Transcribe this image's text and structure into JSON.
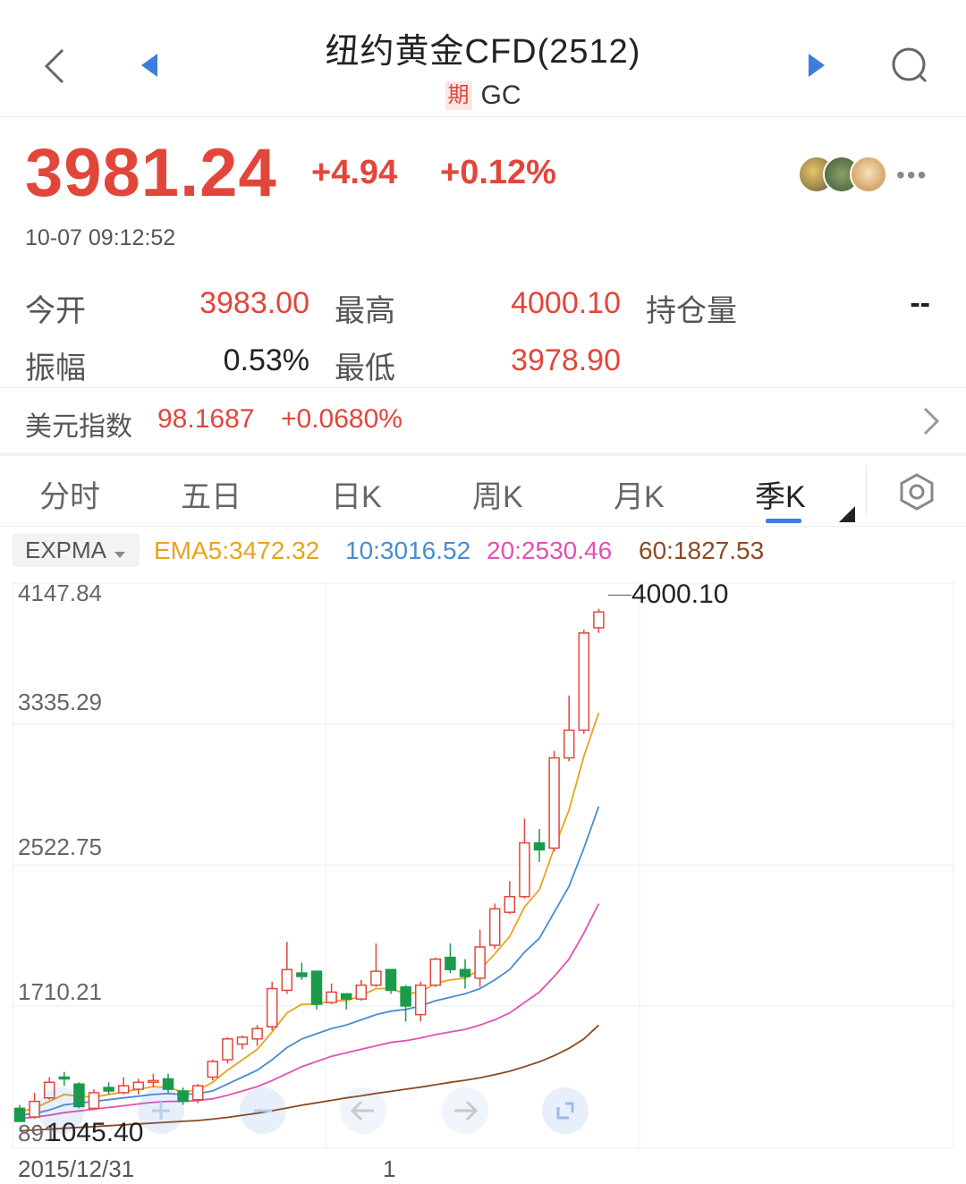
{
  "header": {
    "title": "纽约黄金CFD(2512)",
    "badge": "期",
    "code": "GC"
  },
  "quote": {
    "price": "3981.24",
    "change": "+4.94",
    "change_pct": "+0.12%",
    "timestamp": "10-07 09:12:52"
  },
  "stats": {
    "open_label": "今开",
    "open_value": "3983.00",
    "high_label": "最高",
    "high_value": "4000.10",
    "oi_label": "持仓量",
    "oi_value": "--",
    "amp_label": "振幅",
    "amp_value": "0.53%",
    "low_label": "最低",
    "low_value": "3978.90"
  },
  "dollar_index": {
    "label": "美元指数",
    "value": "98.1687",
    "change": "+0.0680%"
  },
  "tabs": [
    "分时",
    "五日",
    "日K",
    "周K",
    "月K",
    "季K"
  ],
  "active_tab": 5,
  "indicator": {
    "name": "EXPMA",
    "ema5": "EMA5:3472.32",
    "ema10": "10:3016.52",
    "ema20": "20:2530.46",
    "ema60": "60:1827.53"
  },
  "colors": {
    "up": "#e2463b",
    "down": "#1a9a4a",
    "ema5": "#e8a41a",
    "ema10": "#4a8ccf",
    "ema20": "#e251b4",
    "ema60": "#8b4a22",
    "accent": "#3b7ddd"
  },
  "chart_data": {
    "type": "candlestick",
    "y_ticks": [
      "4147.84",
      "3335.29",
      "2522.75",
      "1710.21",
      "891"
    ],
    "x_start_label": "2015/12/31",
    "x_end_label": "1",
    "max_label": "4000.10",
    "min_label": "1045.40",
    "ylim": [
      890,
      4147.84
    ],
    "candles": [
      {
        "o": 1120,
        "c": 1045,
        "h": 1140,
        "l": 1045
      },
      {
        "o": 1070,
        "c": 1160,
        "h": 1210,
        "l": 1060
      },
      {
        "o": 1180,
        "c": 1270,
        "h": 1300,
        "l": 1170
      },
      {
        "o": 1300,
        "c": 1290,
        "h": 1330,
        "l": 1250
      },
      {
        "o": 1260,
        "c": 1130,
        "h": 1270,
        "l": 1120
      },
      {
        "o": 1120,
        "c": 1210,
        "h": 1230,
        "l": 1110
      },
      {
        "o": 1240,
        "c": 1220,
        "h": 1270,
        "l": 1200
      },
      {
        "o": 1210,
        "c": 1250,
        "h": 1300,
        "l": 1200
      },
      {
        "o": 1230,
        "c": 1270,
        "h": 1290,
        "l": 1200
      },
      {
        "o": 1270,
        "c": 1280,
        "h": 1320,
        "l": 1240
      },
      {
        "o": 1290,
        "c": 1230,
        "h": 1320,
        "l": 1210
      },
      {
        "o": 1220,
        "c": 1160,
        "h": 1240,
        "l": 1140
      },
      {
        "o": 1170,
        "c": 1250,
        "h": 1260,
        "l": 1150
      },
      {
        "o": 1300,
        "c": 1390,
        "h": 1400,
        "l": 1280
      },
      {
        "o": 1400,
        "c": 1520,
        "h": 1530,
        "l": 1380
      },
      {
        "o": 1490,
        "c": 1530,
        "h": 1540,
        "l": 1460
      },
      {
        "o": 1520,
        "c": 1580,
        "h": 1600,
        "l": 1480
      },
      {
        "o": 1590,
        "c": 1810,
        "h": 1850,
        "l": 1570
      },
      {
        "o": 1800,
        "c": 1920,
        "h": 2080,
        "l": 1780
      },
      {
        "o": 1900,
        "c": 1880,
        "h": 1960,
        "l": 1860
      },
      {
        "o": 1910,
        "c": 1720,
        "h": 1910,
        "l": 1690
      },
      {
        "o": 1730,
        "c": 1790,
        "h": 1840,
        "l": 1720
      },
      {
        "o": 1780,
        "c": 1750,
        "h": 1780,
        "l": 1690
      },
      {
        "o": 1750,
        "c": 1830,
        "h": 1860,
        "l": 1740
      },
      {
        "o": 1830,
        "c": 1910,
        "h": 2070,
        "l": 1820
      },
      {
        "o": 1920,
        "c": 1800,
        "h": 1920,
        "l": 1780
      },
      {
        "o": 1820,
        "c": 1710,
        "h": 1830,
        "l": 1620
      },
      {
        "o": 1660,
        "c": 1830,
        "h": 1850,
        "l": 1620
      },
      {
        "o": 1830,
        "c": 1980,
        "h": 1990,
        "l": 1820
      },
      {
        "o": 1990,
        "c": 1920,
        "h": 2070,
        "l": 1900
      },
      {
        "o": 1920,
        "c": 1880,
        "h": 1980,
        "l": 1810
      },
      {
        "o": 1870,
        "c": 2050,
        "h": 2150,
        "l": 1820
      },
      {
        "o": 2060,
        "c": 2270,
        "h": 2300,
        "l": 2040
      },
      {
        "o": 2250,
        "c": 2340,
        "h": 2430,
        "l": 2240
      },
      {
        "o": 2340,
        "c": 2650,
        "h": 2790,
        "l": 2330
      },
      {
        "o": 2650,
        "c": 2610,
        "h": 2730,
        "l": 2540
      },
      {
        "o": 2620,
        "c": 3140,
        "h": 3180,
        "l": 2600
      },
      {
        "o": 3140,
        "c": 3300,
        "h": 3500,
        "l": 3120
      },
      {
        "o": 3300,
        "c": 3860,
        "h": 3880,
        "l": 3280
      },
      {
        "o": 3890,
        "c": 3981,
        "h": 4000,
        "l": 3860
      }
    ],
    "ema5": [
      1100,
      1120,
      1160,
      1200,
      1190,
      1185,
      1200,
      1215,
      1230,
      1245,
      1240,
      1215,
      1225,
      1270,
      1340,
      1400,
      1460,
      1560,
      1670,
      1720,
      1720,
      1740,
      1740,
      1770,
      1810,
      1810,
      1780,
      1790,
      1840,
      1860,
      1870,
      1920,
      2010,
      2110,
      2280,
      2380,
      2620,
      2840,
      3150,
      3400
    ],
    "ema10": [
      1080,
      1090,
      1110,
      1140,
      1150,
      1160,
      1170,
      1180,
      1190,
      1200,
      1205,
      1200,
      1205,
      1220,
      1260,
      1300,
      1340,
      1400,
      1470,
      1520,
      1550,
      1580,
      1600,
      1630,
      1660,
      1680,
      1690,
      1710,
      1740,
      1760,
      1780,
      1810,
      1860,
      1920,
      2020,
      2100,
      2250,
      2400,
      2620,
      2860
    ],
    "ema20": [
      1060,
      1070,
      1080,
      1095,
      1105,
      1115,
      1125,
      1135,
      1145,
      1155,
      1160,
      1160,
      1165,
      1175,
      1195,
      1220,
      1245,
      1280,
      1320,
      1360,
      1390,
      1420,
      1440,
      1460,
      1480,
      1500,
      1510,
      1525,
      1545,
      1560,
      1575,
      1600,
      1630,
      1670,
      1730,
      1790,
      1880,
      1980,
      2130,
      2300
    ],
    "ema60": [
      990,
      995,
      1000,
      1005,
      1010,
      1015,
      1020,
      1025,
      1030,
      1035,
      1040,
      1045,
      1050,
      1058,
      1068,
      1080,
      1092,
      1106,
      1122,
      1138,
      1152,
      1166,
      1180,
      1192,
      1206,
      1218,
      1230,
      1242,
      1256,
      1270,
      1282,
      1296,
      1314,
      1334,
      1360,
      1388,
      1424,
      1466,
      1520,
      1600
    ]
  }
}
